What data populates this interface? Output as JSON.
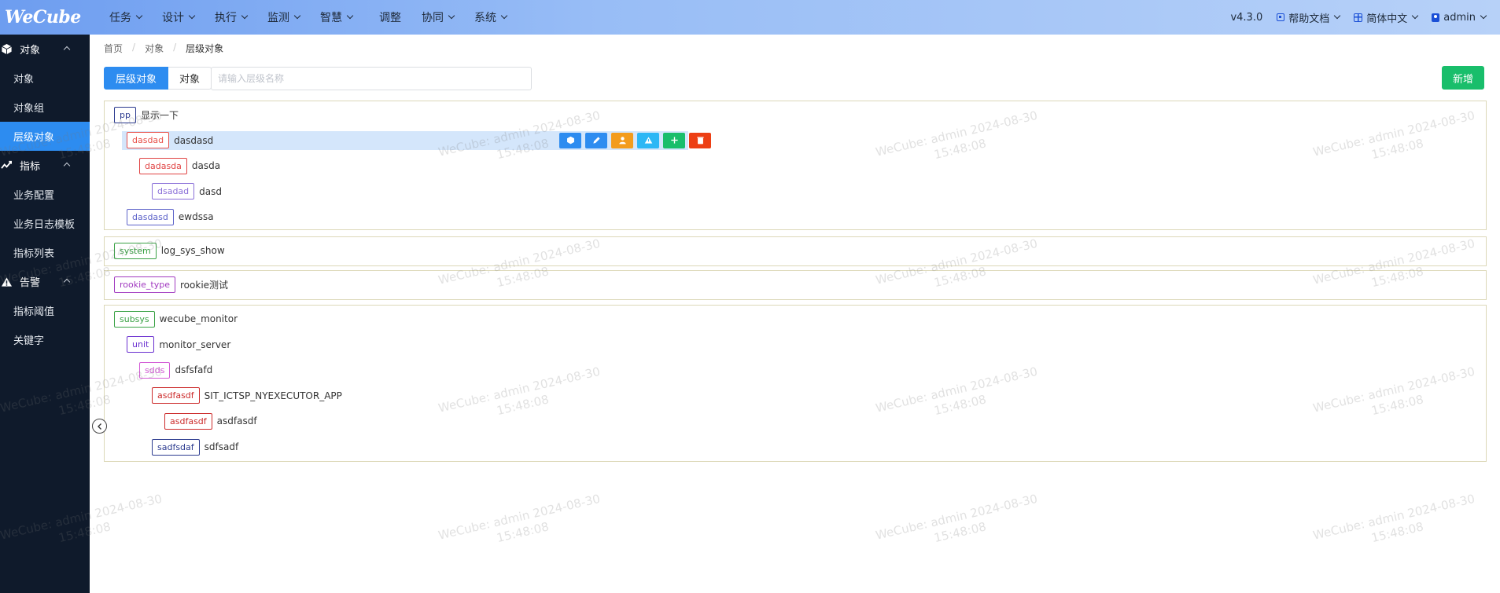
{
  "header": {
    "logo": "WeCube",
    "nav": [
      {
        "label": "任务",
        "has_dropdown": true
      },
      {
        "label": "设计",
        "has_dropdown": true
      },
      {
        "label": "执行",
        "has_dropdown": true
      },
      {
        "label": "监测",
        "has_dropdown": true
      },
      {
        "label": "智慧",
        "has_dropdown": true
      },
      {
        "label": "调整",
        "has_dropdown": false
      },
      {
        "label": "协同",
        "has_dropdown": true
      },
      {
        "label": "系统",
        "has_dropdown": true
      }
    ],
    "version": "v4.3.0",
    "help": "帮助文档",
    "language": "简体中文",
    "user": "admin"
  },
  "sidebar": {
    "groups": [
      {
        "label": "对象",
        "icon": "cube-icon",
        "items": [
          {
            "label": "对象",
            "active": false
          },
          {
            "label": "对象组",
            "active": false
          },
          {
            "label": "层级对象",
            "active": true
          }
        ]
      },
      {
        "label": "指标",
        "icon": "chart-line-icon",
        "items": [
          {
            "label": "业务配置",
            "active": false
          },
          {
            "label": "业务日志模板",
            "active": false
          },
          {
            "label": "指标列表",
            "active": false
          }
        ]
      },
      {
        "label": "告警",
        "icon": "warning-icon",
        "items": [
          {
            "label": "指标阈值",
            "active": false
          },
          {
            "label": "关键字",
            "active": false
          }
        ]
      }
    ]
  },
  "breadcrumb": [
    "首页",
    "对象",
    "层级对象"
  ],
  "tabs": [
    {
      "label": "层级对象",
      "active": true
    },
    {
      "label": "对象",
      "active": false
    }
  ],
  "search": {
    "placeholder": "请输入层级名称",
    "value": ""
  },
  "add_button": "新增",
  "colors": {
    "accent": "#2d8cf0",
    "success": "#19be6b",
    "sidebar_bg": "#0f1a2b",
    "selected_row": "#d4e6fb",
    "card_border": "#dcd8b8"
  },
  "tree_groups": [
    {
      "nodes": [
        {
          "tag": "pp",
          "name": "显示一下",
          "level": 0,
          "tag_color": "#2b3a8f"
        },
        {
          "tag": "dasdad",
          "name": "dasdasd",
          "level": 1,
          "tag_color": "#e8504a",
          "selected": true
        },
        {
          "tag": "dadasda",
          "name": "dasda",
          "level": 2,
          "tag_color": "#e04343"
        },
        {
          "tag": "dsadad",
          "name": "dasd",
          "level": 3,
          "tag_color": "#8a6fd8"
        },
        {
          "tag": "dasdasd",
          "name": "ewdssa",
          "level": 1,
          "tag_color": "#5d63c9"
        }
      ]
    },
    {
      "nodes": [
        {
          "tag": "system",
          "name": "log_sys_show",
          "level": 0,
          "tag_color": "#3aa245"
        }
      ]
    },
    {
      "nodes": [
        {
          "tag": "rookie_type",
          "name": "rookie测试",
          "level": 0,
          "tag_color": "#a13ac0"
        }
      ]
    },
    {
      "nodes": [
        {
          "tag": "subsys",
          "name": "wecube_monitor",
          "level": 0,
          "tag_color": "#3aa245"
        },
        {
          "tag": "unit",
          "name": "monitor_server",
          "level": 1,
          "tag_color": "#6a2fd0"
        },
        {
          "tag": "sdds",
          "name": "dsfsfafd",
          "level": 2,
          "tag_color": "#d35cd6"
        },
        {
          "tag": "asdfasdf",
          "name": "SIT_ICTSP_NYEXECUTOR_APP",
          "level": 3,
          "tag_color": "#cc2b2b"
        },
        {
          "tag": "asdfasdf",
          "name": "asdfasdf",
          "level": 4,
          "tag_color": "#cc2b2b"
        },
        {
          "tag": "sadfsdaf",
          "name": "sdfsadf",
          "level": 3,
          "tag_color": "#2b3a8f"
        }
      ]
    }
  ],
  "row_actions": [
    {
      "icon": "cube-icon",
      "color": "#2d8cf0"
    },
    {
      "icon": "edit-icon",
      "color": "#2d8cf0"
    },
    {
      "icon": "user-icon",
      "color": "#f39c1d"
    },
    {
      "icon": "warning-icon",
      "color": "#2db7f5"
    },
    {
      "icon": "plus-icon",
      "color": "#19be6b"
    },
    {
      "icon": "delete-icon",
      "color": "#ed3f14"
    }
  ],
  "watermark": {
    "line1": "WeCube: admin 2024-08-30",
    "line2": "15:48:08"
  }
}
